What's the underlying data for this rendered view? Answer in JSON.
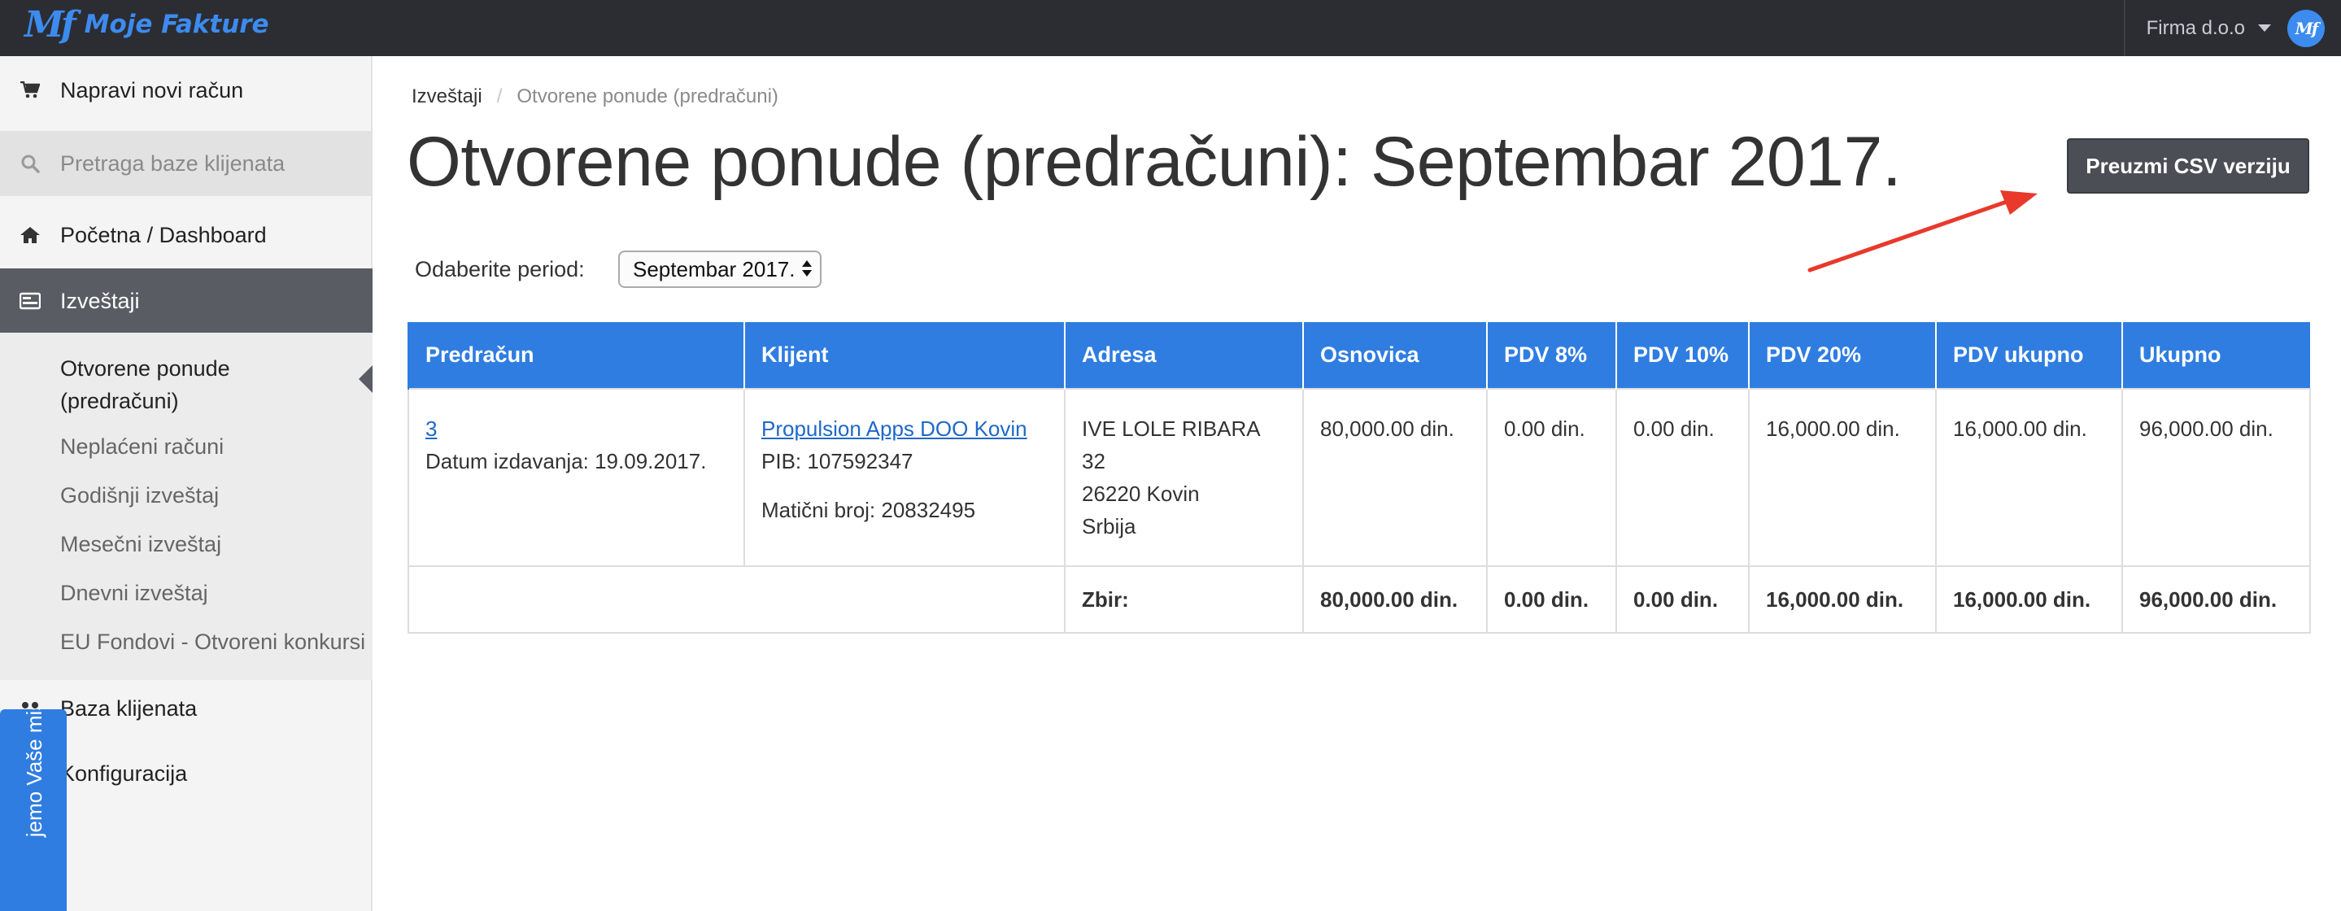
{
  "brand": {
    "mark": "Mf",
    "name": "Moje Fakture"
  },
  "account": {
    "name": "Firma d.o.o",
    "avatar": "Mf"
  },
  "sidebar": {
    "items": [
      {
        "label": "Napravi novi račun",
        "icon": "cart-icon"
      },
      {
        "placeholder": "Pretraga baze klijenata",
        "icon": "search-icon"
      },
      {
        "label": "Početna / Dashboard",
        "icon": "home-icon"
      },
      {
        "label": "Izveštaji",
        "icon": "reports-icon"
      },
      {
        "label": "Baza klijenata",
        "icon": "users-icon"
      },
      {
        "label": "Konfiguracija",
        "icon": "gear-icon"
      }
    ],
    "submenu": [
      {
        "label": "Otvorene ponude (predračuni)"
      },
      {
        "label": "Neplaćeni računi"
      },
      {
        "label": "Godišnji izveštaj"
      },
      {
        "label": "Mesečni izveštaj"
      },
      {
        "label": "Dnevni izveštaj"
      },
      {
        "label": "EU Fondovi - Otvoreni konkursi"
      }
    ],
    "feedback_tab": "jemo Vaše mišljenje"
  },
  "breadcrumb": {
    "parent": "Izveštaji",
    "separator": "/",
    "current": "Otvorene ponude (predračuni)"
  },
  "page_title": "Otvorene ponude (predračuni): Septembar 2017.",
  "csv_button": "Preuzmi CSV verziju",
  "period": {
    "label": "Odaberite period:",
    "selected": "Septembar 2017."
  },
  "table": {
    "headers": [
      "Predračun",
      "Klijent",
      "Adresa",
      "Osnovica",
      "PDV 8%",
      "PDV 10%",
      "PDV 20%",
      "PDV ukupno",
      "Ukupno"
    ],
    "row": {
      "number": "3",
      "date": "Datum izdavanja: 19.09.2017.",
      "client_name": "Propulsion Apps DOO Kovin",
      "client_pib": "PIB: 107592347",
      "client_mb": "Matični broj: 20832495",
      "address_line1": "IVE LOLE RIBARA 32",
      "address_line2": "26220 Kovin",
      "address_line3": "Srbija",
      "osnovica": "80,000.00 din.",
      "pdv8": "0.00 din.",
      "pdv10": "0.00 din.",
      "pdv20": "16,000.00 din.",
      "pdv_total": "16,000.00 din.",
      "total": "96,000.00 din."
    },
    "totals": {
      "label": "Zbir:",
      "osnovica": "80,000.00 din.",
      "pdv8": "0.00 din.",
      "pdv10": "0.00 din.",
      "pdv20": "16,000.00 din.",
      "pdv_total": "16,000.00 din.",
      "total": "96,000.00 din."
    }
  },
  "colors": {
    "topbar": "#2b2d33",
    "brand": "#3d8bef",
    "table_header": "#2f7de1",
    "active_nav": "#595c63",
    "annotation_arrow": "#e8392b"
  }
}
